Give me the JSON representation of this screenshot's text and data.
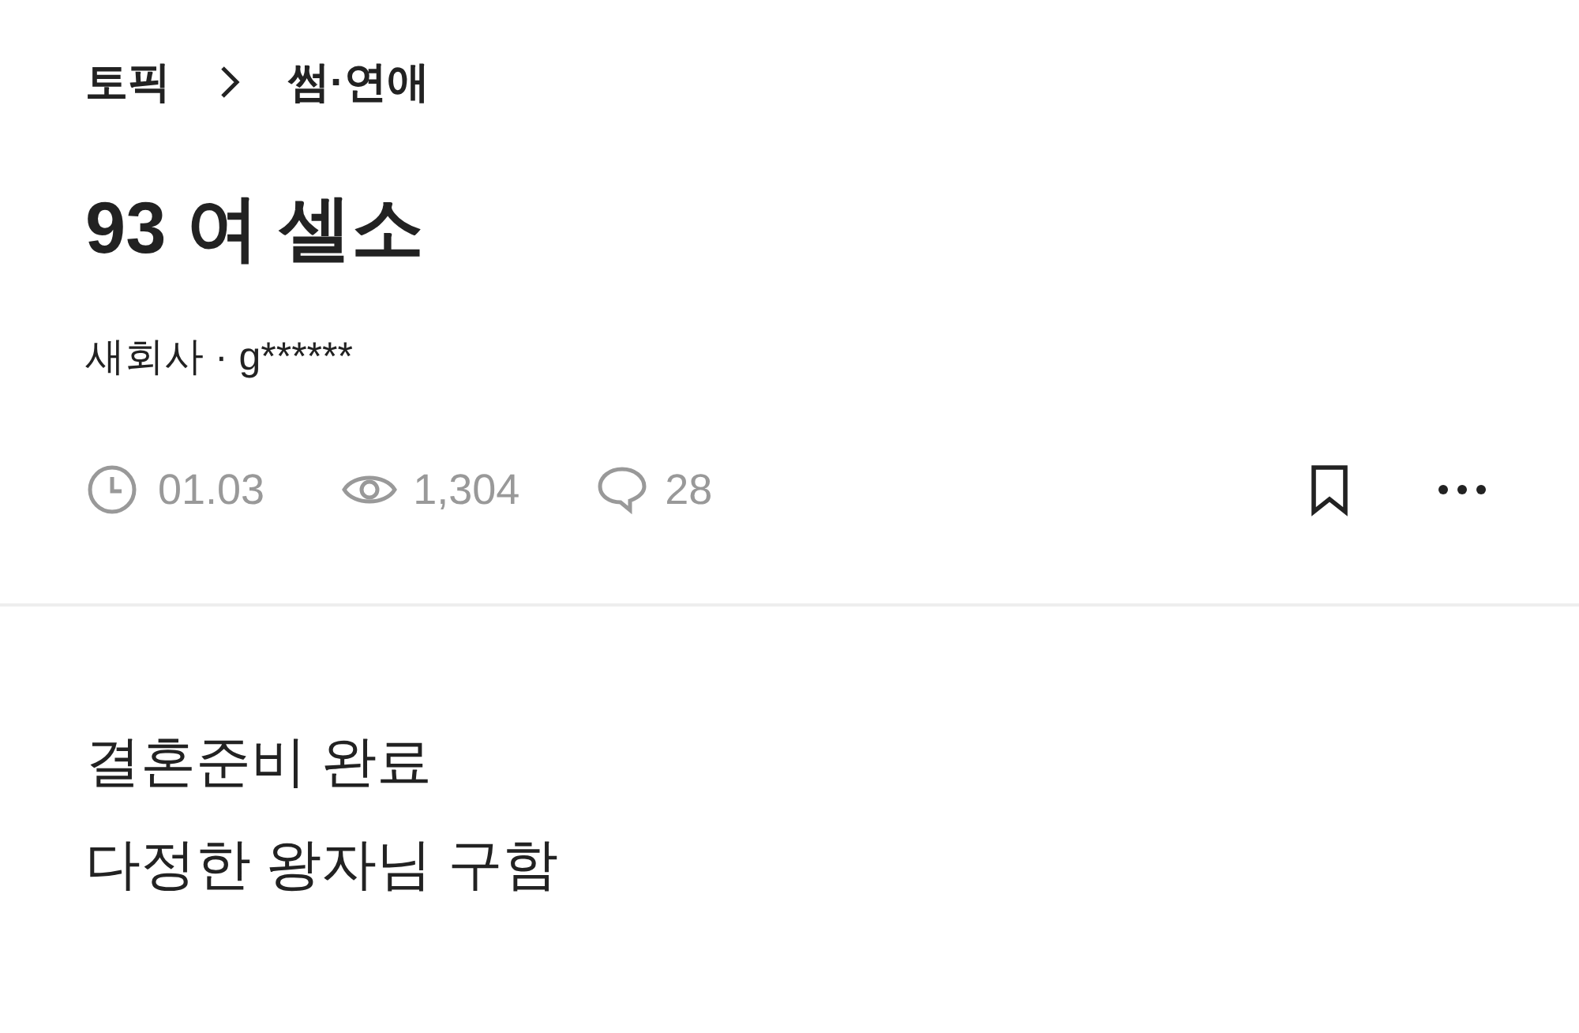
{
  "breadcrumb": [
    "토픽",
    "썸·연애"
  ],
  "title": "93 여 셀소",
  "author": "새회사 · g******",
  "stats": {
    "date": "01.03",
    "views": "1,304",
    "comments": "28"
  },
  "body": [
    "결혼준비 완료",
    "다정한 왕자님 구함"
  ]
}
